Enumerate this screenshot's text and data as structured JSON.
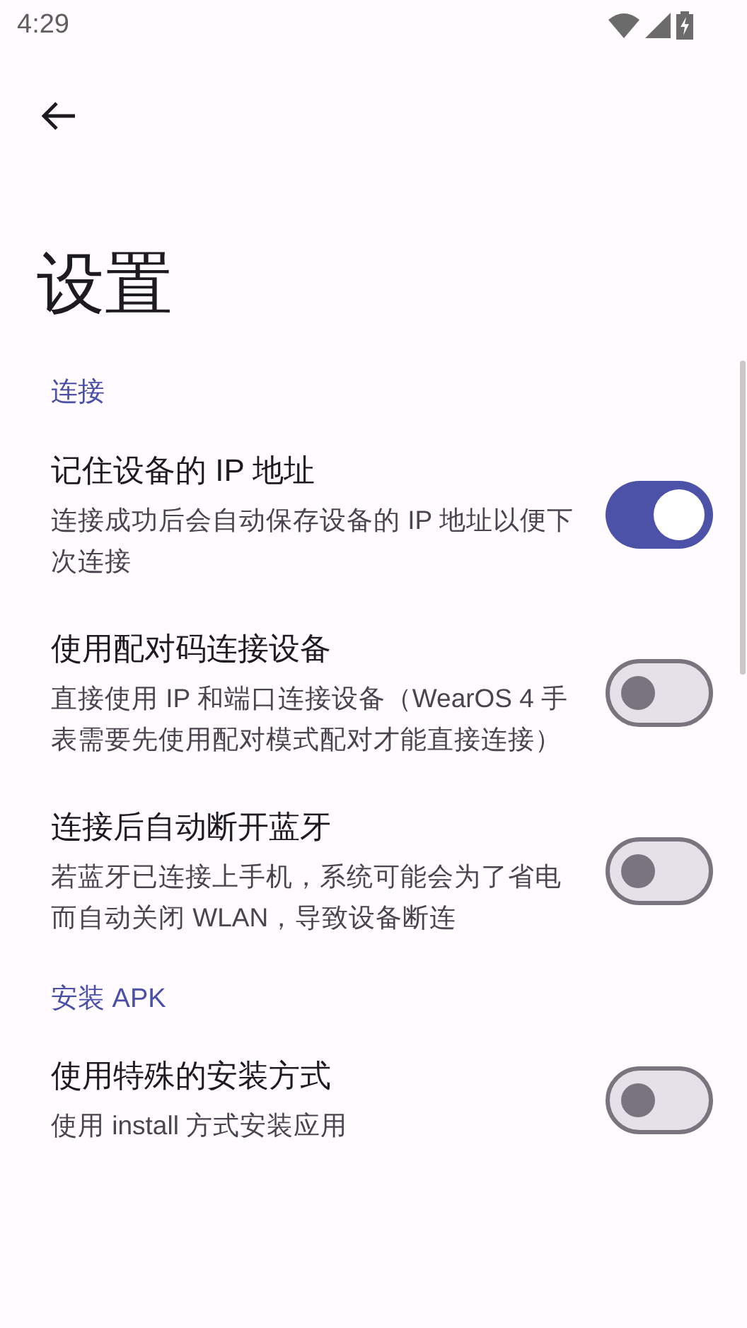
{
  "status_bar": {
    "time": "4:29"
  },
  "title": "设置",
  "sections": [
    {
      "header": "连接",
      "items": [
        {
          "title": "记住设备的 IP 地址",
          "subtitle": "连接成功后会自动保存设备的 IP 地址以便下次连接",
          "on": true
        },
        {
          "title": "使用配对码连接设备",
          "subtitle": "直接使用 IP 和端口连接设备（WearOS 4 手表需要先使用配对模式配对才能直接连接）",
          "on": false
        },
        {
          "title": "连接后自动断开蓝牙",
          "subtitle": "若蓝牙已连接上手机，系统可能会为了省电而自动关闭 WLAN，导致设备断连",
          "on": false
        }
      ]
    },
    {
      "header": "安装 APK",
      "items": [
        {
          "title": "使用特殊的安装方式",
          "subtitle": "使用 install 方式安装应用",
          "on": false
        }
      ]
    }
  ]
}
